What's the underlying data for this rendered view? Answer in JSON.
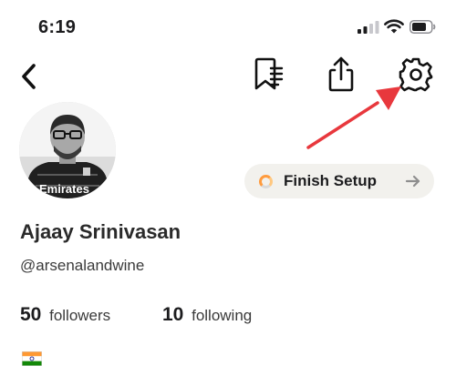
{
  "status_bar": {
    "time": "6:19"
  },
  "profile": {
    "name": "Ajaay Srinivasan",
    "username": "@arsenalandwine",
    "avatar_jersey_text": "Emirates",
    "flag": "🇮🇳"
  },
  "finish_setup": {
    "label": "Finish Setup"
  },
  "stats": {
    "followers": {
      "count": "50",
      "label": "followers"
    },
    "following": {
      "count": "10",
      "label": "following"
    }
  },
  "icons": {
    "back": "chevron-left-icon",
    "bookmark": "bookmark-list-icon",
    "share": "share-icon",
    "settings": "gear-icon",
    "annotation": "red-arrow-icon"
  },
  "colors": {
    "annotation_arrow": "#e8383d",
    "setup_ring": "#ff9b3d",
    "setup_pill_bg": "#f2f1ed"
  }
}
